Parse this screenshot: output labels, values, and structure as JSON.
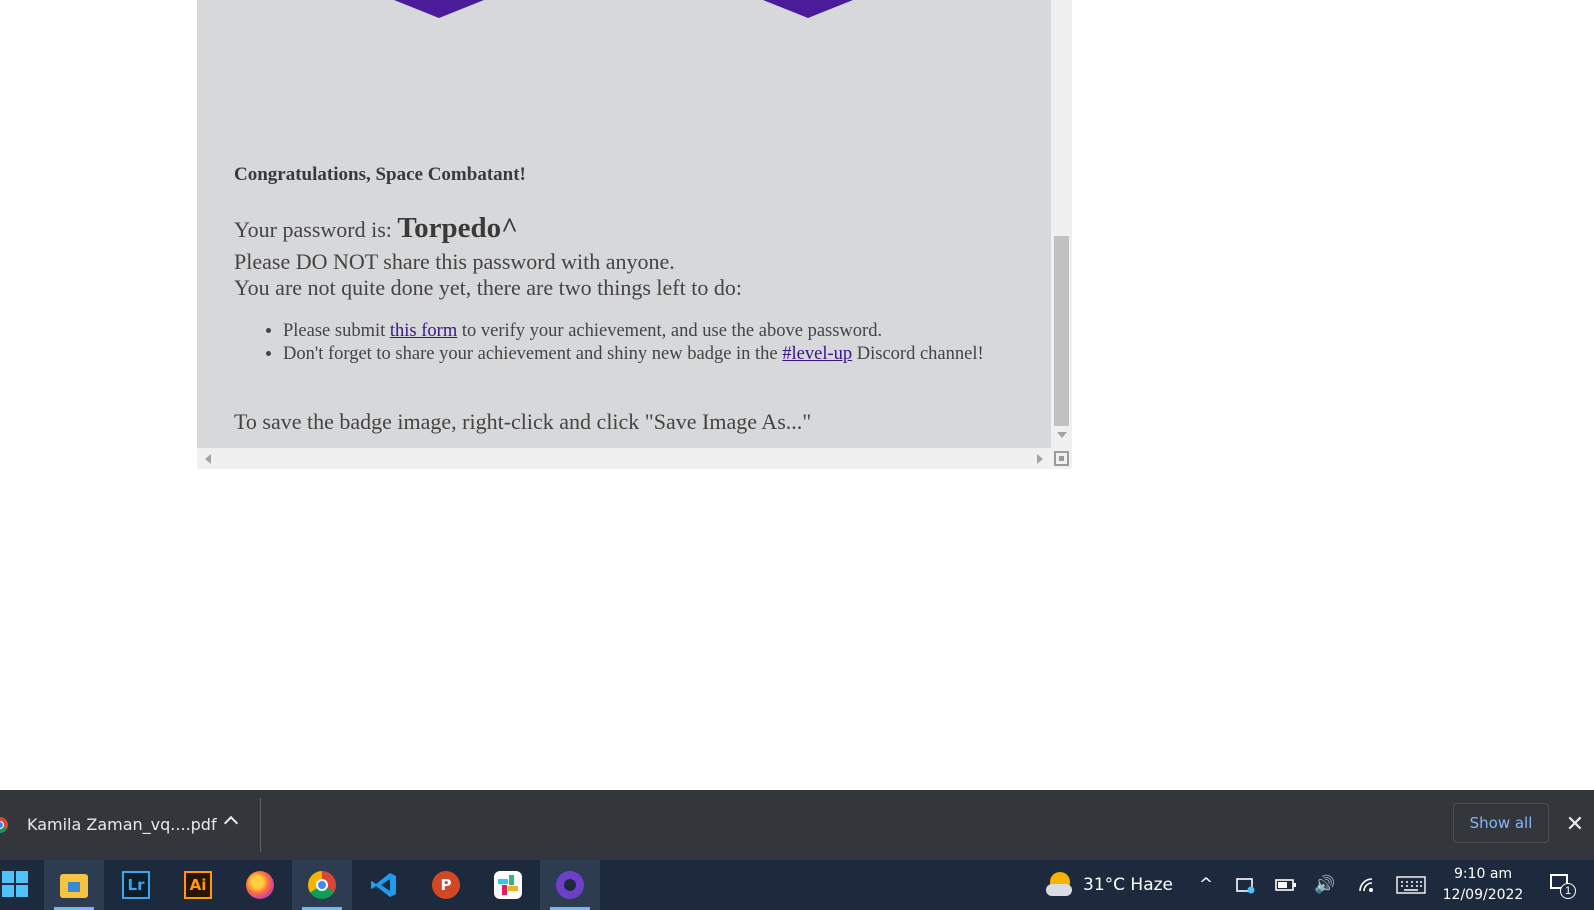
{
  "page": {
    "congrats": "Congratulations, Space Combatant!",
    "password_prefix": "Your password is:",
    "password_value": "Torpedo^",
    "no_share": "Please DO NOT share this password with anyone.",
    "not_done": "You are not quite done yet, there are two things left to do:",
    "todo": {
      "item1_before": "Please submit",
      "item1_link": "this form",
      "item1_after": "to verify your achievement, and use the above password.",
      "item2_before": "Don't forget to share your achievement and shiny new badge in the",
      "item2_link": "#level-up",
      "item2_after": "Discord channel!"
    },
    "save_note": "To save the badge image, right-click and click \"Save Image As...\"",
    "badge_color": "#4b1c9a",
    "link_color": "#3a1585"
  },
  "downloads_bar": {
    "file_name": "Kamila Zaman_vq....pdf",
    "show_all": "Show all",
    "close_symbol": "✕"
  },
  "taskbar": {
    "apps": [
      "start-icon",
      "file-explorer-icon",
      "lightroom-icon",
      "illustrator-icon",
      "firefox-icon",
      "chrome-icon",
      "vscode-icon",
      "powerpoint-icon",
      "slack-icon",
      "github-desktop-icon"
    ],
    "lightroom_label": "Lr",
    "illustrator_label": "Ai",
    "powerpoint_label": "P",
    "weather": "31°C  Haze",
    "time": "9:10 am",
    "date": "12/09/2022",
    "notification_count": "1",
    "tray_up": "^",
    "volume_glyph": "🔊"
  }
}
